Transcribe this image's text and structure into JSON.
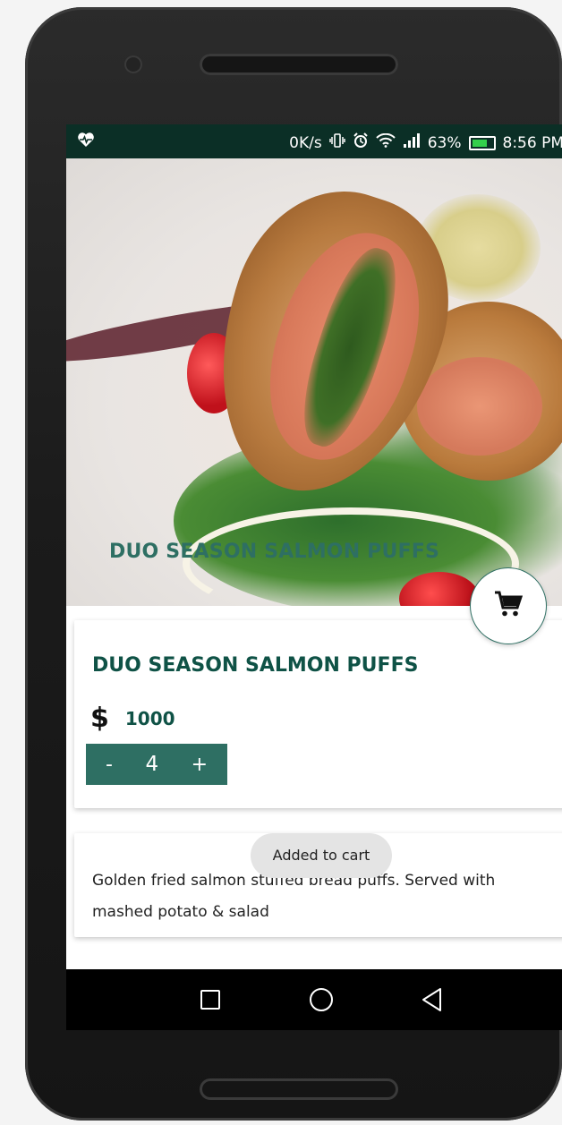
{
  "status_bar": {
    "network_speed": "0K/s",
    "battery_percent": "63%",
    "time": "8:56 PM",
    "icons": [
      "heart-pulse-icon",
      "vibrate-icon",
      "alarm-icon",
      "wifi-icon",
      "signal-icon",
      "battery-icon"
    ]
  },
  "hero": {
    "title": "DUO SEASON SALMON PUFFS"
  },
  "product": {
    "title": "DUO SEASON SALMON PUFFS",
    "currency_symbol": "$",
    "price": "1000",
    "quantity": {
      "minus_label": "-",
      "value": "4",
      "plus_label": "+"
    }
  },
  "description": {
    "text": "Golden fried salmon stuffed bread puffs. Served with mashed potato & salad"
  },
  "toast": {
    "message": "Added to cart"
  },
  "colors": {
    "status_bar": "#0b2f26",
    "accent": "#2e6f63",
    "title_text": "#0f5246"
  },
  "nav_bar": {
    "icons": [
      "recents-square-icon",
      "home-circle-icon",
      "back-triangle-icon"
    ]
  }
}
